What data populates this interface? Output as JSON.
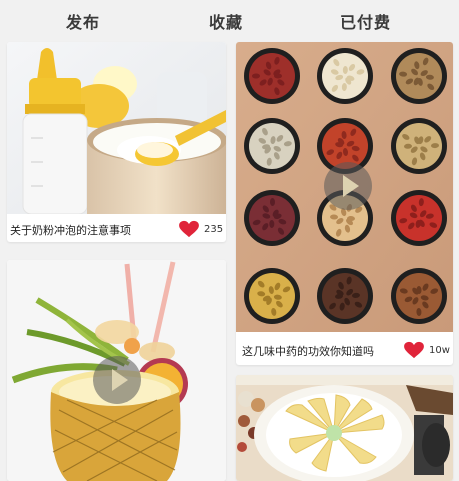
{
  "tabs": [
    {
      "label": "发布"
    },
    {
      "label": "收藏"
    },
    {
      "label": "已付费"
    }
  ],
  "feed": {
    "cards": [
      {
        "title": "关于奶粉冲泡的注意事项",
        "likes": "235",
        "image": "milk-powder-bottle-photo",
        "is_video": false
      },
      {
        "title": "这几味中药的功效你知道吗",
        "likes": "10w",
        "image": "herbal-medicine-bowls-photo",
        "is_video": true
      },
      {
        "title": "",
        "likes": "",
        "image": "pineapple-drink-photo",
        "is_video": true
      },
      {
        "title": "",
        "likes": "",
        "image": "sliced-dish-photo",
        "is_video": false
      }
    ]
  },
  "colors": {
    "heart": "#e0243a",
    "background": "#f1f1f1"
  }
}
